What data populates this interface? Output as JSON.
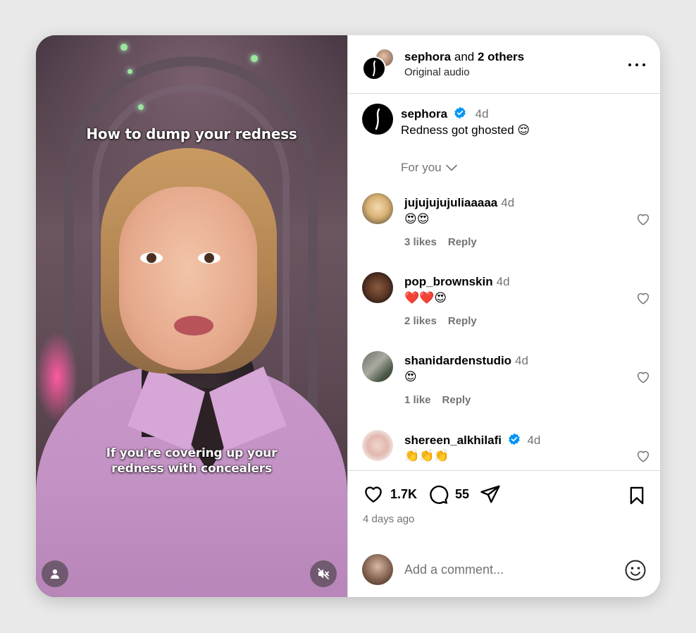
{
  "video": {
    "caption_top": "How to dump your redness",
    "caption_bottom": "If you're covering up your redness with concealers"
  },
  "header": {
    "account": "sephora",
    "and_text": "and",
    "others": "2 others",
    "audio": "Original audio"
  },
  "post": {
    "username": "sephora",
    "time": "4d",
    "caption": "Redness got ghosted 😌"
  },
  "filter": {
    "label": "For you"
  },
  "comments": [
    {
      "username": "jujujujujuliaaaaa",
      "time": "4d",
      "text": "😍😍",
      "likes": "3 likes",
      "reply": "Reply"
    },
    {
      "username": "pop_brownskin",
      "time": "4d",
      "text": "❤️❤️😍",
      "likes": "2 likes",
      "reply": "Reply"
    },
    {
      "username": "shanidardenstudio",
      "time": "4d",
      "text": "😍",
      "likes": "1 like",
      "reply": "Reply"
    },
    {
      "username": "shereen_alkhilafi",
      "time": "4d",
      "text": "👏👏👏",
      "likes": "",
      "reply": ""
    }
  ],
  "actions": {
    "likes": "1.7K",
    "comments": "55",
    "posted": "4 days ago"
  },
  "add_comment": {
    "placeholder": "Add a comment..."
  },
  "icons": {
    "like": "heart-icon",
    "comment": "comment-bubble-icon",
    "share": "paper-plane-icon",
    "save": "bookmark-icon",
    "more": "more-dots-icon",
    "emoji": "emoji-smile-icon",
    "mute": "muted-speaker-icon",
    "user_tag": "user-icon",
    "verified": "verified-badge-icon"
  },
  "colors": {
    "verified": "#0095f6",
    "secondary_text": "#737373",
    "divider": "#dbdbdb"
  }
}
